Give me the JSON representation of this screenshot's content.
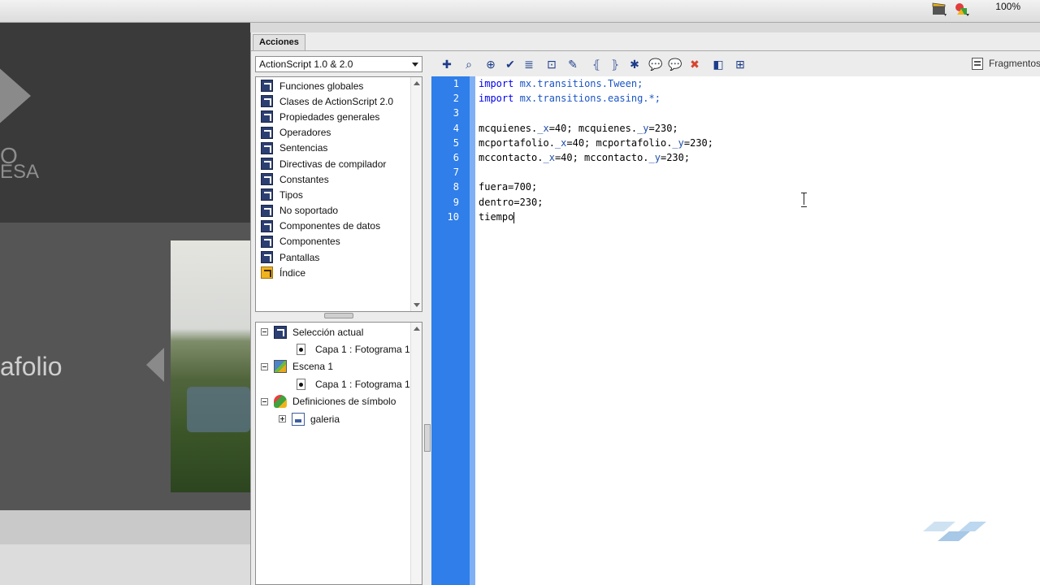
{
  "toolbar": {
    "zoom": "100%",
    "icons": [
      "clapper-board-icon",
      "symbols-icon"
    ]
  },
  "stage": {
    "text_top_1": "O",
    "text_top_2": "ESA",
    "text_folio": "afolio"
  },
  "panel": {
    "tab_label": "Acciones",
    "language_select": "ActionScript 1.0 & 2.0",
    "toolbox_items": [
      {
        "label": "Funciones globales",
        "icon": "book-icon"
      },
      {
        "label": "Clases de ActionScript 2.0",
        "icon": "book-icon"
      },
      {
        "label": "Propiedades generales",
        "icon": "book-icon"
      },
      {
        "label": "Operadores",
        "icon": "book-icon"
      },
      {
        "label": "Sentencias",
        "icon": "book-icon"
      },
      {
        "label": "Directivas de compilador",
        "icon": "book-icon"
      },
      {
        "label": "Constantes",
        "icon": "book-icon"
      },
      {
        "label": "Tipos",
        "icon": "book-icon"
      },
      {
        "label": "No soportado",
        "icon": "book-icon"
      },
      {
        "label": "Componentes de datos",
        "icon": "book-icon"
      },
      {
        "label": "Componentes",
        "icon": "book-icon"
      },
      {
        "label": "Pantallas",
        "icon": "book-icon"
      },
      {
        "label": "Índice",
        "icon": "index-icon"
      }
    ],
    "navigator": [
      {
        "label": "Selección actual",
        "level": 0,
        "expander": "minus",
        "icon": "selection-icon"
      },
      {
        "label": "Capa 1 : Fotograma 1",
        "level": 1,
        "expander": "",
        "icon": "frame-icon"
      },
      {
        "label": "Escena 1",
        "level": 0,
        "expander": "minus",
        "icon": "scene-icon"
      },
      {
        "label": "Capa 1 : Fotograma 1",
        "level": 1,
        "expander": "",
        "icon": "frame-icon"
      },
      {
        "label": "Definiciones de símbolo",
        "level": 0,
        "expander": "minus",
        "icon": "symbols-icon"
      },
      {
        "label": "galeria",
        "level": 1,
        "expander": "plus",
        "icon": "movieclip-icon"
      }
    ],
    "editor_toolbar": {
      "buttons": [
        "add-statement-icon",
        "find-icon",
        "insert-target-path-icon",
        "check-syntax-icon",
        "auto-format-icon",
        "show-code-hint-icon",
        "debug-options-icon",
        "collapse-between-braces-icon",
        "collapse-selection-icon",
        "expand-all-icon",
        "apply-block-comment-icon",
        "apply-line-comment-icon",
        "remove-comment-icon",
        "show-hide-toolbox-icon",
        "script-assist-icon"
      ],
      "fragments_label": "Fragmentos"
    },
    "code_lines": [
      {
        "n": "1",
        "html": "<span class=\"kw\">import</span> <span class=\"ns\">mx.transitions.Tween;</span>"
      },
      {
        "n": "2",
        "html": "<span class=\"kw\">import</span> <span class=\"ns\">mx.transitions.easing.*;</span>"
      },
      {
        "n": "3",
        "html": ""
      },
      {
        "n": "4",
        "html": "mcquienes.<span class=\"under\">_x</span>=40; mcquienes.<span class=\"under\">_y</span>=230;"
      },
      {
        "n": "5",
        "html": "mcportafolio.<span class=\"under\">_x</span>=40; mcportafolio.<span class=\"under\">_y</span>=230;"
      },
      {
        "n": "6",
        "html": "mccontacto.<span class=\"under\">_x</span>=40; mccontacto.<span class=\"under\">_y</span>=230;"
      },
      {
        "n": "7",
        "html": ""
      },
      {
        "n": "8",
        "html": "fuera=700;"
      },
      {
        "n": "9",
        "html": "dentro=230;"
      },
      {
        "n": "10",
        "html": "tiempo"
      }
    ]
  }
}
